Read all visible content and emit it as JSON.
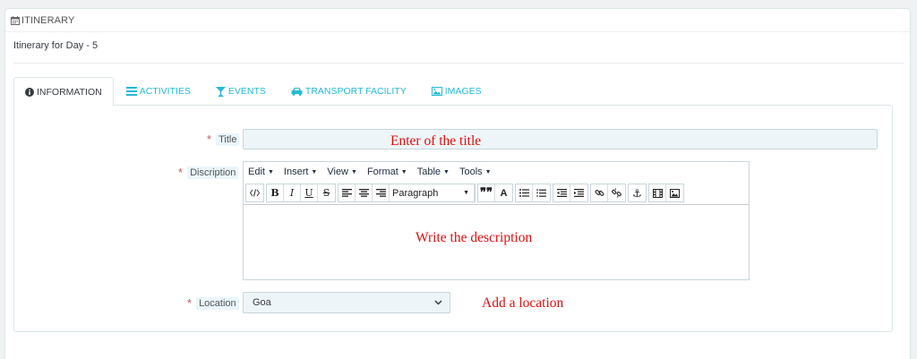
{
  "panel": {
    "heading": "ITINERARY",
    "day_title": "Itinerary for Day - 5"
  },
  "tabs": [
    {
      "label": "INFORMATION",
      "icon": "info-circle-icon",
      "active": true
    },
    {
      "label": "ACTIVITIES",
      "icon": "list-icon",
      "active": false
    },
    {
      "label": "EVENTS",
      "icon": "cocktail-icon",
      "active": false
    },
    {
      "label": "TRANSPORT FACILITY",
      "icon": "car-icon",
      "active": false
    },
    {
      "label": "IMAGES",
      "icon": "image-icon",
      "active": false
    }
  ],
  "form": {
    "title": {
      "label": "Title",
      "required": "*",
      "value": ""
    },
    "description": {
      "label": "Discription",
      "required": "*"
    },
    "location": {
      "label": "Location",
      "required": "*",
      "value": "Goa"
    }
  },
  "editor": {
    "menus": [
      "Edit",
      "Insert",
      "View",
      "Format",
      "Table",
      "Tools"
    ],
    "format_value": "Paragraph"
  },
  "annotations": {
    "title_hint": "Enter of the title",
    "description_hint": "Write the description",
    "location_hint": "Add a location"
  },
  "colors": {
    "accent": "#25b9d7",
    "annotation": "#e40b0b",
    "required": "#c05c67"
  }
}
